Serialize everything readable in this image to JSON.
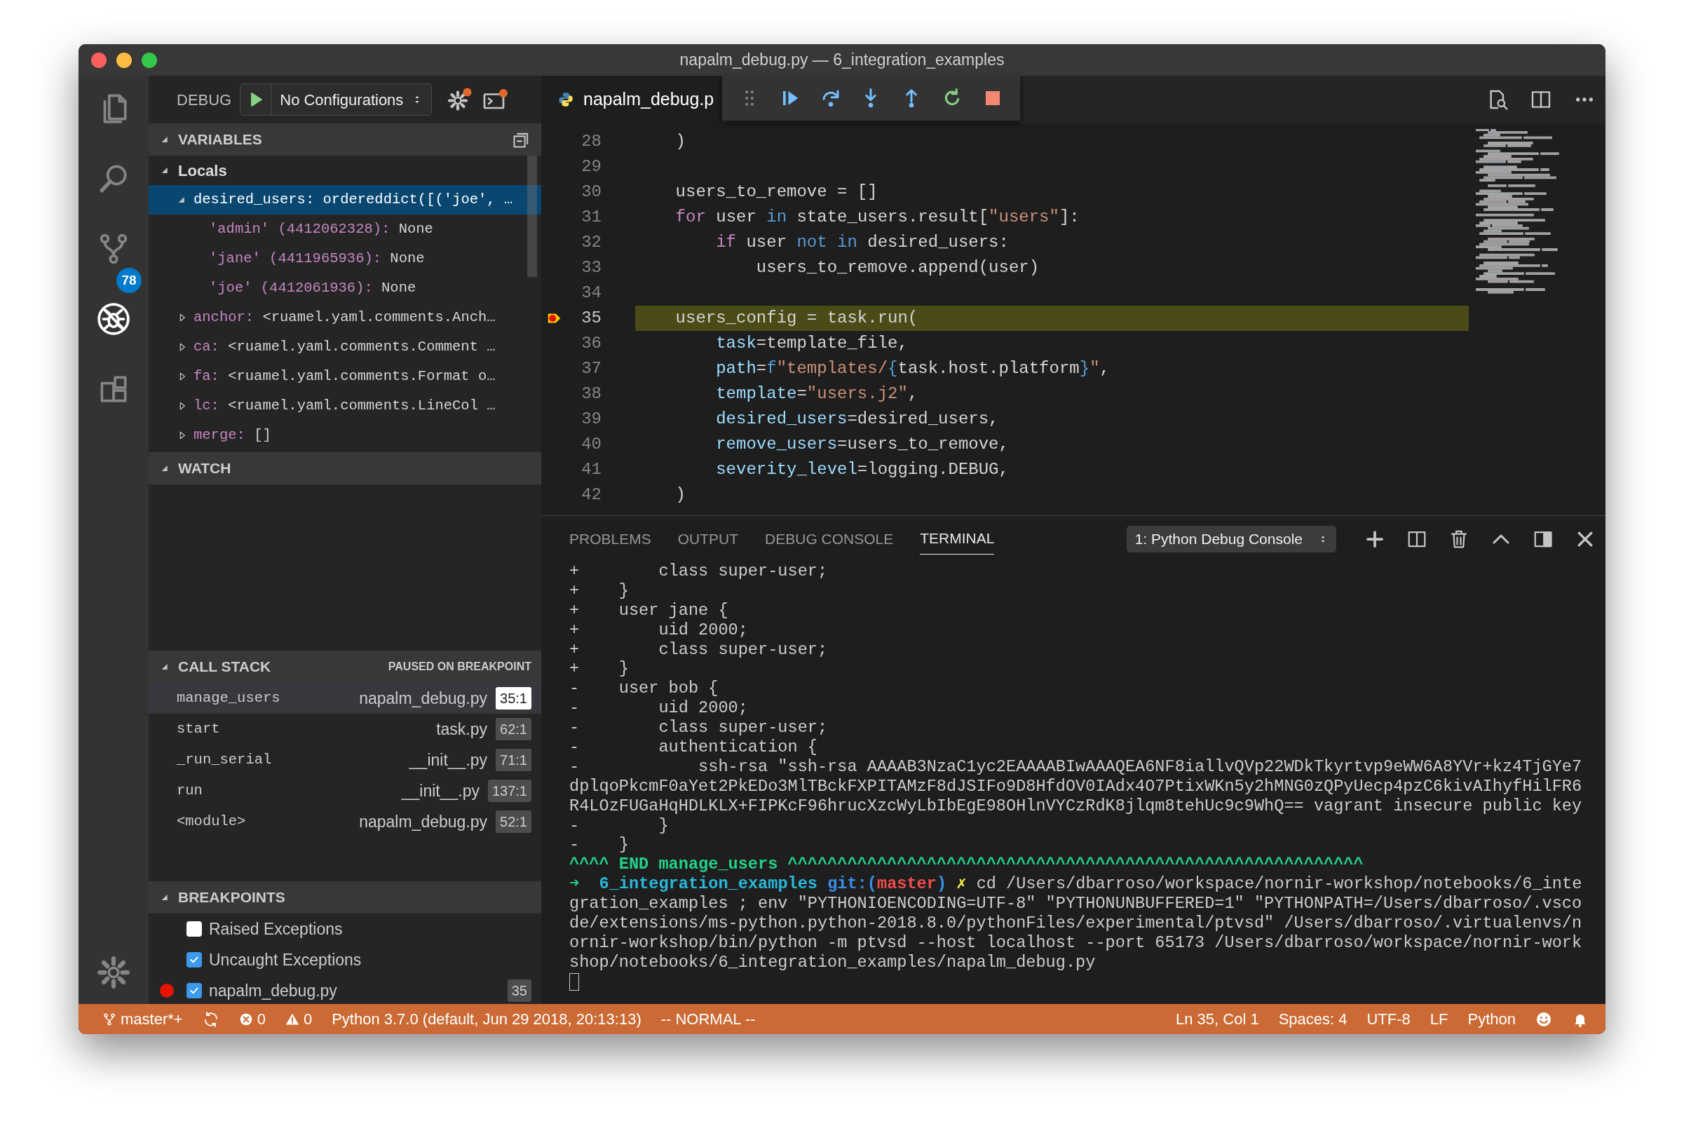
{
  "window": {
    "title": "napalm_debug.py — 6_integration_examples"
  },
  "activity_bar": [
    {
      "kind": "explorer",
      "selected": false
    },
    {
      "kind": "search",
      "selected": false
    },
    {
      "kind": "source-control",
      "selected": false,
      "badge": "78"
    },
    {
      "kind": "debug",
      "selected": true
    },
    {
      "kind": "extensions",
      "selected": false
    },
    {
      "kind": "settings",
      "selected": false
    }
  ],
  "debug_header": {
    "label": "DEBUG",
    "configuration": "No Configurations"
  },
  "variables": {
    "title": "VARIABLES",
    "expanded": true,
    "scopes": [
      {
        "name": "Locals",
        "expanded": true,
        "items": [
          {
            "name": "desired_users:",
            "value": "ordereddict([('joe', …",
            "expanded": true,
            "selected": true,
            "children": [
              {
                "name": "'admin' (4412062328):",
                "value": "None",
                "selected": false
              },
              {
                "name": "'jane' (4411965936):",
                "value": "None",
                "selected": false
              },
              {
                "name": "'joe' (4412061936):",
                "value": "None",
                "selected": false
              }
            ]
          },
          {
            "name": "anchor:",
            "value": "<ruamel.yaml.comments.Anch…",
            "expanded": false,
            "selected": false
          },
          {
            "name": "ca:",
            "value": "<ruamel.yaml.comments.Comment …",
            "expanded": false,
            "selected": false
          },
          {
            "name": "fa:",
            "value": "<ruamel.yaml.comments.Format o…",
            "expanded": false,
            "selected": false
          },
          {
            "name": "lc:",
            "value": "<ruamel.yaml.comments.LineCol …",
            "expanded": false,
            "selected": false
          },
          {
            "name": "merge:",
            "value": "[]",
            "expanded": false,
            "selected": false
          }
        ]
      }
    ]
  },
  "watch": {
    "title": "WATCH",
    "expanded": true
  },
  "call_stack": {
    "title": "CALL STACK",
    "status": "PAUSED ON BREAKPOINT",
    "expanded": true,
    "frames": [
      {
        "function": "manage_users",
        "file": "napalm_debug.py",
        "position": "35:1",
        "selected": true
      },
      {
        "function": "start",
        "file": "task.py",
        "position": "62:1",
        "selected": false
      },
      {
        "function": "_run_serial",
        "file": "__init__.py",
        "position": "71:1",
        "selected": false
      },
      {
        "function": "run",
        "file": "__init__.py",
        "position": "137:1",
        "selected": false
      },
      {
        "function": "<module>",
        "file": "napalm_debug.py",
        "position": "52:1",
        "selected": false
      }
    ]
  },
  "breakpoints": {
    "title": "BREAKPOINTS",
    "expanded": true,
    "items": [
      {
        "kind": "exception",
        "label": "Raised Exceptions",
        "checked": false
      },
      {
        "kind": "exception",
        "label": "Uncaught Exceptions",
        "checked": true
      },
      {
        "kind": "source",
        "label": "napalm_debug.py",
        "checked": true,
        "line": "35"
      }
    ]
  },
  "editor": {
    "tab": "napalm_debug.p",
    "lines": [
      {
        "number": "28",
        "current": false,
        "breakpoint": false,
        "tokens": [
          {
            "text": "    )",
            "kind": "plain"
          }
        ]
      },
      {
        "number": "29",
        "current": false,
        "breakpoint": false
      },
      {
        "number": "30",
        "current": false,
        "breakpoint": false,
        "tokens": [
          {
            "text": "    users_to_remove = []",
            "kind": "plain"
          }
        ]
      },
      {
        "number": "31",
        "current": false,
        "breakpoint": false,
        "tokens": [
          {
            "text": "    for",
            "kind": "control"
          },
          {
            "text": " user ",
            "kind": "plain"
          },
          {
            "text": "in",
            "kind": "keyword"
          },
          {
            "text": " state_users.result[",
            "kind": "plain"
          },
          {
            "text": "\"users\"",
            "kind": "string"
          },
          {
            "text": "]:",
            "kind": "plain"
          }
        ]
      },
      {
        "number": "32",
        "current": false,
        "breakpoint": false,
        "tokens": [
          {
            "text": "        if",
            "kind": "control"
          },
          {
            "text": " user ",
            "kind": "plain"
          },
          {
            "text": "not",
            "kind": "keyword"
          },
          {
            "text": " in",
            "kind": "keyword"
          },
          {
            "text": " desired_users:",
            "kind": "plain"
          }
        ]
      },
      {
        "number": "33",
        "current": false,
        "breakpoint": false,
        "tokens": [
          {
            "text": "            users_to_remove.append(user)",
            "kind": "plain"
          }
        ]
      },
      {
        "number": "34",
        "current": false,
        "breakpoint": false
      },
      {
        "number": "35",
        "current": true,
        "breakpoint": true,
        "tokens": [
          {
            "text": "    users_config = task.run(",
            "kind": "plain"
          }
        ]
      },
      {
        "number": "36",
        "current": false,
        "breakpoint": false,
        "tokens": [
          {
            "text": "        task",
            "kind": "param"
          },
          {
            "text": "=template_file,",
            "kind": "plain"
          }
        ]
      },
      {
        "number": "37",
        "current": false,
        "breakpoint": false,
        "tokens": [
          {
            "text": "        path",
            "kind": "param"
          },
          {
            "text": "=",
            "kind": "plain"
          },
          {
            "text": "f",
            "kind": "keyword"
          },
          {
            "text": "\"templates/",
            "kind": "string"
          },
          {
            "text": "{",
            "kind": "keyword"
          },
          {
            "text": "task.host.platform",
            "kind": "plain"
          },
          {
            "text": "}",
            "kind": "keyword"
          },
          {
            "text": "\"",
            "kind": "string"
          },
          {
            "text": ",",
            "kind": "plain"
          }
        ]
      },
      {
        "number": "38",
        "current": false,
        "breakpoint": false,
        "tokens": [
          {
            "text": "        template",
            "kind": "param"
          },
          {
            "text": "=",
            "kind": "plain"
          },
          {
            "text": "\"users.j2\"",
            "kind": "string"
          },
          {
            "text": ",",
            "kind": "plain"
          }
        ]
      },
      {
        "number": "39",
        "current": false,
        "breakpoint": false,
        "tokens": [
          {
            "text": "        desired_users",
            "kind": "param"
          },
          {
            "text": "=desired_users,",
            "kind": "plain"
          }
        ]
      },
      {
        "number": "40",
        "current": false,
        "breakpoint": false,
        "tokens": [
          {
            "text": "        remove_users",
            "kind": "param"
          },
          {
            "text": "=users_to_remove,",
            "kind": "plain"
          }
        ]
      },
      {
        "number": "41",
        "current": false,
        "breakpoint": false,
        "tokens": [
          {
            "text": "        severity_level",
            "kind": "param"
          },
          {
            "text": "=logging.DEBUG,",
            "kind": "plain"
          }
        ]
      },
      {
        "number": "42",
        "current": false,
        "breakpoint": false,
        "tokens": [
          {
            "text": "    )",
            "kind": "plain"
          }
        ]
      }
    ]
  },
  "panel": {
    "tabs": [
      {
        "label": "PROBLEMS",
        "selected": false
      },
      {
        "label": "OUTPUT",
        "selected": false
      },
      {
        "label": "DEBUG CONSOLE",
        "selected": false
      },
      {
        "label": "TERMINAL",
        "selected": true
      }
    ],
    "terminal_selector": "1: Python Debug Console",
    "terminal_lines": [
      {
        "text": "+        class super-user;"
      },
      {
        "text": "+    }"
      },
      {
        "text": "+    user jane {"
      },
      {
        "text": "+        uid 2000;"
      },
      {
        "text": "+        class super-user;"
      },
      {
        "text": "+    }"
      },
      {
        "text": "-    user bob {"
      },
      {
        "text": "-        uid 2000;"
      },
      {
        "text": "-        class super-user;"
      },
      {
        "text": "-        authentication {"
      },
      {
        "text": "-            ssh-rsa \"ssh-rsa AAAAB3NzaC1yc2EAAAABIwAAAQEA6NF8iallvQVp22WDkTkyrtvp9eWW6A8YVr+kz4TjGYe7"
      },
      {
        "text": "dplqoPkcmF0aYet2PkEDo3MlTBckFXPITAMzF8dJSIFo9D8HfdOV0IAdx4O7PtixWKn5y2hMNG0zQPyUecp4pzC6kivAIhyfHilFR6"
      },
      {
        "text": "R4LOzFUGaHqHDLKLX+FIPKcF96hrucXzcWyLbIbEgE98OHlnVYCzRdK8jlqm8tehUc9c9WhQ== vagrant insecure public key"
      },
      {
        "text": "-        }"
      },
      {
        "text": "-    }"
      },
      {
        "tokens": [
          {
            "text": "^^^^ END manage_users ^^^^^^^^^^^^^^^^^^^^^^^^^^^^^^^^^^^^^^^^^^^^^^^^^^^^^^^^^^",
            "kind": "banner"
          }
        ]
      },
      {
        "tokens": [
          {
            "text": "➜  ",
            "kind": "arrow"
          },
          {
            "text": "6_integration_examples",
            "kind": "directory"
          },
          {
            "text": " git:(",
            "kind": "git"
          },
          {
            "text": "master",
            "kind": "branch"
          },
          {
            "text": ")",
            "kind": "git"
          },
          {
            "text": " ✗",
            "kind": "dirty"
          },
          {
            "text": " cd /Users/dbarroso/workspace/nornir-workshop/notebooks/6_inte",
            "kind": "plain"
          }
        ]
      },
      {
        "text": "gration_examples ; env \"PYTHONIOENCODING=UTF-8\" \"PYTHONUNBUFFERED=1\" \"PYTHONPATH=/Users/dbarroso/.vsco"
      },
      {
        "text": "de/extensions/ms-python.python-2018.8.0/pythonFiles/experimental/ptvsd\" /Users/dbarroso/.virtualenvs/n"
      },
      {
        "text": "ornir-workshop/bin/python -m ptvsd --host localhost --port 65173 /Users/dbarroso/workspace/nornir-work"
      },
      {
        "text": "shop/notebooks/6_integration_examples/napalm_debug.py"
      }
    ]
  },
  "status_bar": {
    "left": [
      {
        "kind": "branch",
        "text": "master*+"
      },
      {
        "kind": "sync"
      },
      {
        "kind": "errors",
        "text": "0"
      },
      {
        "kind": "warnings",
        "text": "0"
      },
      {
        "kind": "text",
        "text": "Python 3.7.0 (default, Jun 29 2018, 20:13:13)"
      },
      {
        "kind": "text",
        "text": "-- NORMAL --"
      }
    ],
    "right": [
      {
        "kind": "text",
        "text": "Ln 35, Col 1"
      },
      {
        "kind": "text",
        "text": "Spaces: 4"
      },
      {
        "kind": "text",
        "text": "UTF-8"
      },
      {
        "kind": "text",
        "text": "LF"
      },
      {
        "kind": "text",
        "text": "Python"
      },
      {
        "kind": "feedback"
      },
      {
        "kind": "notifications"
      }
    ]
  }
}
